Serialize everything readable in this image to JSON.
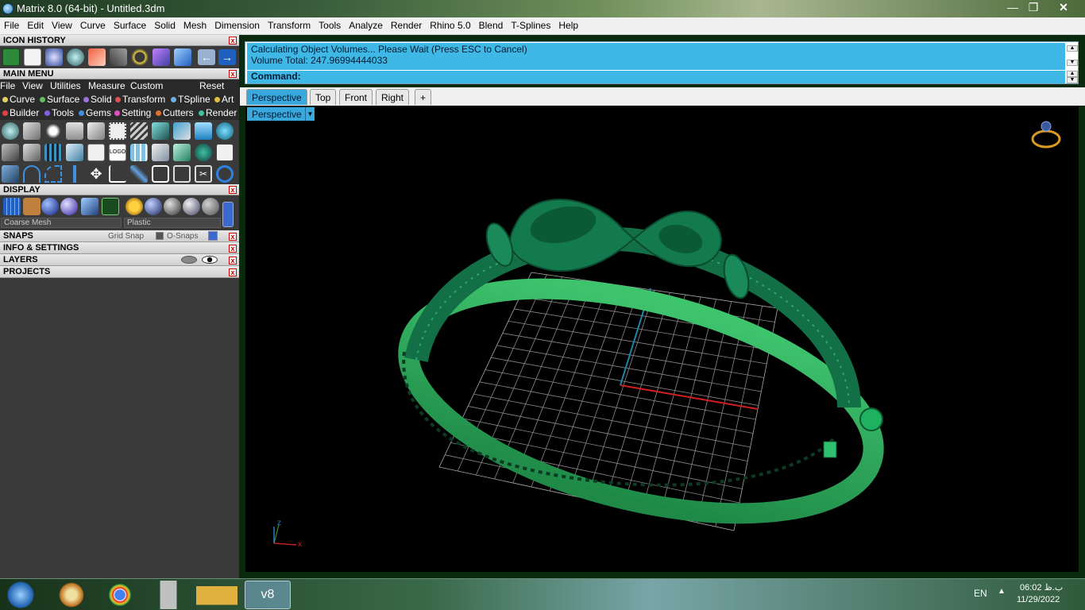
{
  "window": {
    "title": "Matrix 8.0 (64-bit) - Untitled.3dm"
  },
  "menubar": {
    "items": [
      "File",
      "Edit",
      "View",
      "Curve",
      "Surface",
      "Solid",
      "Mesh",
      "Dimension",
      "Transform",
      "Tools",
      "Analyze",
      "Render",
      "Rhino 5.0",
      "Blend",
      "T-Splines",
      "Help"
    ]
  },
  "panels": {
    "icon_history": "ICON HISTORY",
    "main_menu": "MAIN MENU",
    "display": "DISPLAY",
    "snaps": "SNAPS",
    "grid_snap": "Grid Snap",
    "osnaps": "O-Snaps",
    "info": "INFO & SETTINGS",
    "layers": "LAYERS",
    "projects": "PROJECTS"
  },
  "main_menu": {
    "items": [
      "File",
      "View",
      "Utilities",
      "Measure",
      "Custom"
    ],
    "reset": "Reset",
    "categories_row1": [
      {
        "label": "Curve",
        "color": "#e0d060"
      },
      {
        "label": "Surface",
        "color": "#60c060"
      },
      {
        "label": "Solid",
        "color": "#a070e0"
      },
      {
        "label": "Transform",
        "color": "#e05050"
      },
      {
        "label": "TSpline",
        "color": "#70b0e0"
      },
      {
        "label": "Art",
        "color": "#e0c040"
      }
    ],
    "categories_row2": [
      {
        "label": "Builder",
        "color": "#e04040"
      },
      {
        "label": "Tools",
        "color": "#8060e0"
      },
      {
        "label": "Gems",
        "color": "#4090e0"
      },
      {
        "label": "Setting",
        "color": "#e050c0"
      },
      {
        "label": "Cutters",
        "color": "#e07030"
      },
      {
        "label": "Render",
        "color": "#40c0a0"
      }
    ]
  },
  "display": {
    "mesh_option": "Coarse Mesh",
    "material_option": "Plastic"
  },
  "command": {
    "line1": "Calculating Object Volumes... Please Wait (Press ESC to Cancel)",
    "line2": "Volume Total: 247.96994444033",
    "prompt": "Command:"
  },
  "viewport_tabs": [
    "Perspective",
    "Top",
    "Front",
    "Right",
    "+"
  ],
  "viewport": {
    "label": "Perspective",
    "axis_x": "x",
    "axis_z": "z"
  },
  "taskbar": {
    "lang": "EN",
    "time": "06:02 ب.ظ",
    "date": "11/29/2022"
  }
}
